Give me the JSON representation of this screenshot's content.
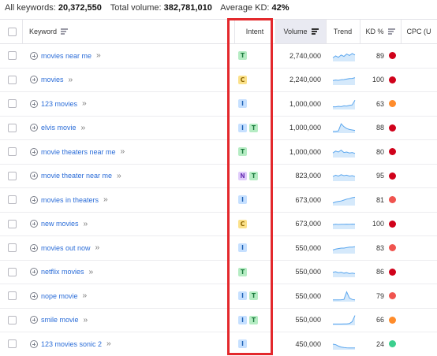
{
  "summary": {
    "all_keywords_label": "All keywords:",
    "all_keywords_value": "20,372,550",
    "total_volume_label": "Total volume:",
    "total_volume_value": "382,781,010",
    "avg_kd_label": "Average KD:",
    "avg_kd_value": "42%"
  },
  "columns": {
    "keyword": "Keyword",
    "intent": "Intent",
    "volume": "Volume",
    "trend": "Trend",
    "kd": "KD %",
    "cpc": "CPC (U"
  },
  "kd_colors": {
    "very_hard": "#d0021b",
    "hard": "#f0544f",
    "difficult": "#ff8c2b",
    "easy": "#3ccf8e"
  },
  "highlight_color": "#e3282c",
  "rows": [
    {
      "keyword": "movies near me",
      "intent": [
        "T"
      ],
      "volume": "2,740,000",
      "kd": "89",
      "kd_color": "#d0021b",
      "trend": [
        0.3,
        0.5,
        0.35,
        0.6,
        0.45,
        0.7,
        0.55,
        0.75,
        0.6
      ]
    },
    {
      "keyword": "movies",
      "intent": [
        "C"
      ],
      "volume": "2,240,000",
      "kd": "100",
      "kd_color": "#d0021b",
      "trend": [
        0.4,
        0.45,
        0.42,
        0.48,
        0.5,
        0.55,
        0.6,
        0.62,
        0.7
      ]
    },
    {
      "keyword": "123 movies",
      "intent": [
        "I"
      ],
      "volume": "1,000,000",
      "kd": "63",
      "kd_color": "#ff8c2b",
      "trend": [
        0.2,
        0.2,
        0.25,
        0.22,
        0.3,
        0.28,
        0.35,
        0.4,
        0.9
      ]
    },
    {
      "keyword": "elvis movie",
      "intent": [
        "I",
        "T"
      ],
      "volume": "1,000,000",
      "kd": "88",
      "kd_color": "#d0021b",
      "trend": [
        0.1,
        0.1,
        0.15,
        0.9,
        0.6,
        0.4,
        0.3,
        0.25,
        0.2
      ]
    },
    {
      "keyword": "movie theaters near me",
      "intent": [
        "T"
      ],
      "volume": "1,000,000",
      "kd": "80",
      "kd_color": "#d0021b",
      "trend": [
        0.4,
        0.6,
        0.5,
        0.7,
        0.45,
        0.5,
        0.4,
        0.45,
        0.35
      ]
    },
    {
      "keyword": "movie theater near me",
      "intent": [
        "N",
        "T"
      ],
      "volume": "823,000",
      "kd": "95",
      "kd_color": "#d0021b",
      "trend": [
        0.4,
        0.55,
        0.45,
        0.6,
        0.5,
        0.55,
        0.45,
        0.5,
        0.4
      ]
    },
    {
      "keyword": "movies in theaters",
      "intent": [
        "I"
      ],
      "volume": "673,000",
      "kd": "81",
      "kd_color": "#f0544f",
      "trend": [
        0.2,
        0.3,
        0.35,
        0.4,
        0.5,
        0.6,
        0.65,
        0.75,
        0.8
      ]
    },
    {
      "keyword": "new movies",
      "intent": [
        "C"
      ],
      "volume": "673,000",
      "kd": "100",
      "kd_color": "#d0021b",
      "trend": [
        0.4,
        0.45,
        0.42,
        0.44,
        0.43,
        0.45,
        0.44,
        0.46,
        0.45
      ]
    },
    {
      "keyword": "movies out now",
      "intent": [
        "I"
      ],
      "volume": "550,000",
      "kd": "83",
      "kd_color": "#f0544f",
      "trend": [
        0.3,
        0.4,
        0.45,
        0.5,
        0.5,
        0.55,
        0.6,
        0.6,
        0.65
      ]
    },
    {
      "keyword": "netflix movies",
      "intent": [
        "T"
      ],
      "volume": "550,000",
      "kd": "86",
      "kd_color": "#d0021b",
      "trend": [
        0.45,
        0.5,
        0.4,
        0.45,
        0.35,
        0.4,
        0.3,
        0.35,
        0.3
      ]
    },
    {
      "keyword": "nope movie",
      "intent": [
        "I",
        "T"
      ],
      "volume": "550,000",
      "kd": "79",
      "kd_color": "#f0544f",
      "trend": [
        0.1,
        0.1,
        0.1,
        0.12,
        0.15,
        0.95,
        0.3,
        0.15,
        0.1
      ]
    },
    {
      "keyword": "smile movie",
      "intent": [
        "I",
        "T"
      ],
      "volume": "550,000",
      "kd": "66",
      "kd_color": "#ff8c2b",
      "trend": [
        0.05,
        0.05,
        0.05,
        0.05,
        0.06,
        0.07,
        0.1,
        0.3,
        0.95
      ]
    },
    {
      "keyword": "123 movies sonic 2",
      "intent": [
        "I"
      ],
      "volume": "450,000",
      "kd": "24",
      "kd_color": "#3ccf8e",
      "trend": [
        0.5,
        0.45,
        0.3,
        0.2,
        0.15,
        0.12,
        0.1,
        0.1,
        0.1
      ]
    }
  ]
}
